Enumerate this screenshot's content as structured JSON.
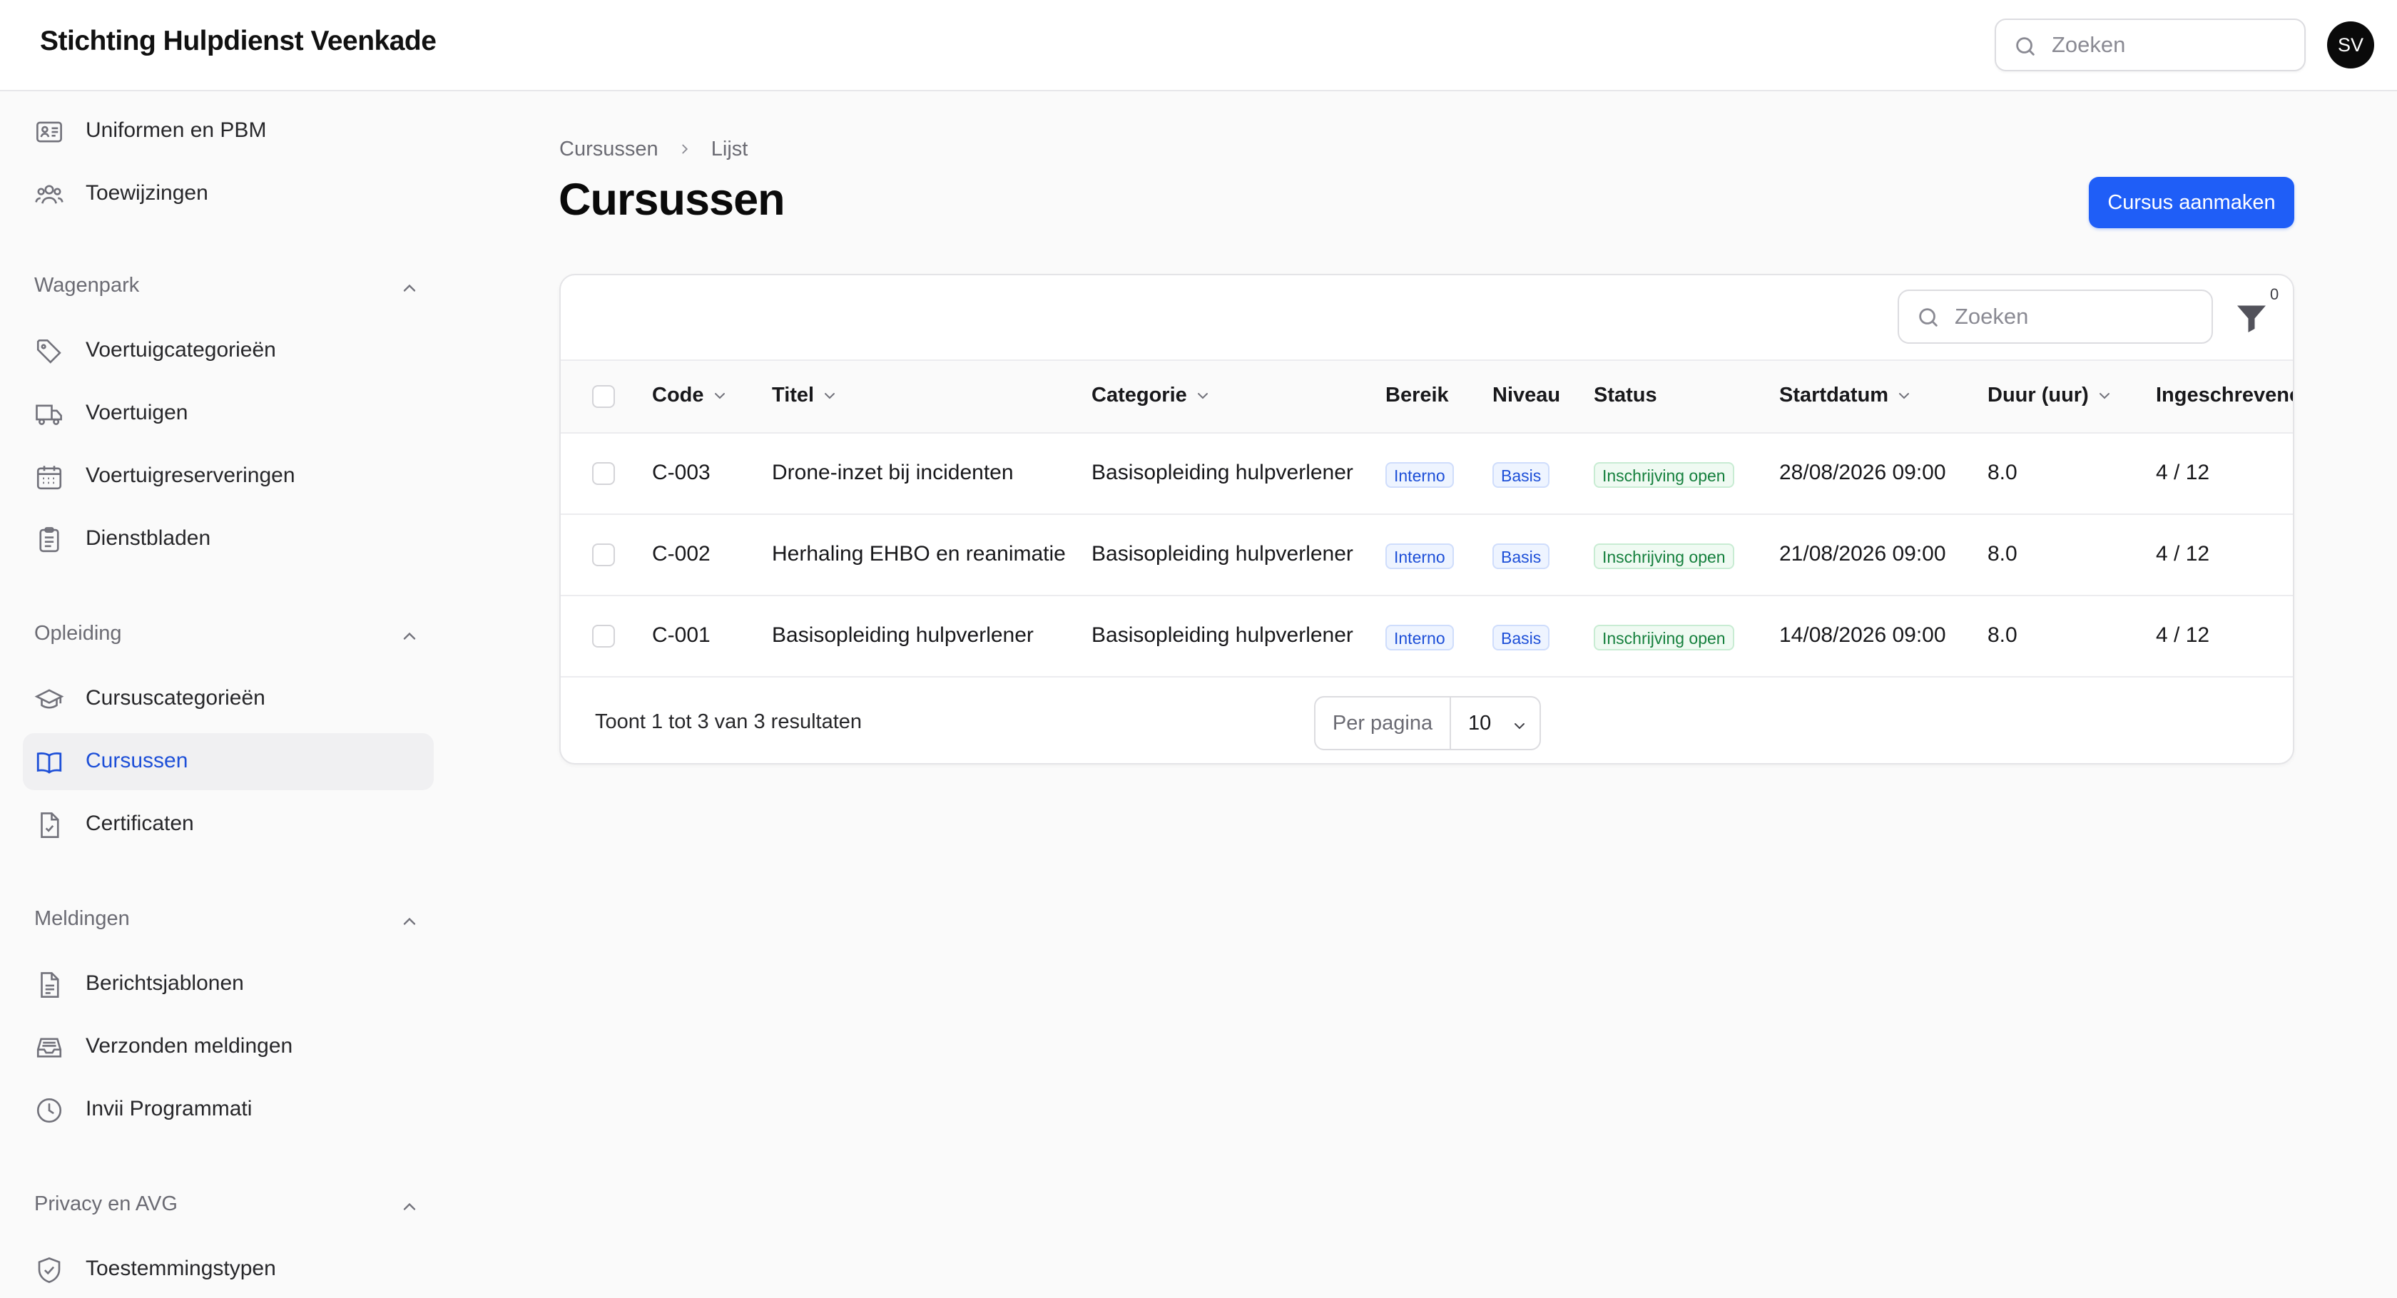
{
  "app": {
    "title": "Stichting Hulpdienst Veenkade",
    "avatar_initials": "SV"
  },
  "header_search": {
    "placeholder": "Zoeken"
  },
  "sidebar": {
    "top_items": [
      {
        "label": "Uniformen en PBM",
        "icon": "id-card-icon"
      },
      {
        "label": "Toewijzingen",
        "icon": "users-icon"
      }
    ],
    "groups": [
      {
        "label": "Wagenpark",
        "items": [
          {
            "label": "Voertuigcategorieën",
            "icon": "tag-icon"
          },
          {
            "label": "Voertuigen",
            "icon": "truck-icon"
          },
          {
            "label": "Voertuigreserveringen",
            "icon": "calendar-icon"
          },
          {
            "label": "Dienstbladen",
            "icon": "clipboard-icon"
          }
        ]
      },
      {
        "label": "Opleiding",
        "items": [
          {
            "label": "Cursuscategorieën",
            "icon": "graduation-cap-icon"
          },
          {
            "label": "Cursussen",
            "icon": "book-open-icon",
            "active": true
          },
          {
            "label": "Certificaten",
            "icon": "document-check-icon"
          }
        ]
      },
      {
        "label": "Meldingen",
        "items": [
          {
            "label": "Berichtsjablonen",
            "icon": "document-text-icon"
          },
          {
            "label": "Verzonden meldingen",
            "icon": "inbox-icon"
          },
          {
            "label": "Invii Programmati",
            "icon": "clock-icon"
          }
        ]
      },
      {
        "label": "Privacy en AVG",
        "items": [
          {
            "label": "Toestemmingstypen",
            "icon": "shield-check-icon"
          }
        ]
      }
    ]
  },
  "breadcrumb": {
    "parent": "Cursussen",
    "current": "Lijst"
  },
  "page": {
    "title": "Cursussen",
    "create_button": "Cursus aanmaken"
  },
  "table": {
    "search_placeholder": "Zoeken",
    "filter_count": "0",
    "columns": {
      "code": "Code",
      "titel": "Titel",
      "categorie": "Categorie",
      "bereik": "Bereik",
      "niveau": "Niveau",
      "status": "Status",
      "startdatum": "Startdatum",
      "duur": "Duur (uur)",
      "ingeschrevenen": "Ingeschrevene"
    },
    "rows": [
      {
        "code": "C-003",
        "titel": "Drone-inzet bij incidenten",
        "categorie": "Basisopleiding hulpverlener",
        "bereik": "Interno",
        "niveau": "Basis",
        "status": "Inschrijving open",
        "startdatum": "28/08/2026 09:00",
        "duur": "8.0",
        "ingeschrevenen": "4 / 12"
      },
      {
        "code": "C-002",
        "titel": "Herhaling EHBO en reanimatie",
        "categorie": "Basisopleiding hulpverlener",
        "bereik": "Interno",
        "niveau": "Basis",
        "status": "Inschrijving open",
        "startdatum": "21/08/2026 09:00",
        "duur": "8.0",
        "ingeschrevenen": "4 / 12"
      },
      {
        "code": "C-001",
        "titel": "Basisopleiding hulpverlener",
        "categorie": "Basisopleiding hulpverlener",
        "bereik": "Interno",
        "niveau": "Basis",
        "status": "Inschrijving open",
        "startdatum": "14/08/2026 09:00",
        "duur": "8.0",
        "ingeschrevenen": "4 / 12"
      }
    ],
    "footer": {
      "summary": "Toont 1 tot 3 van 3 resultaten",
      "per_page_label": "Per pagina",
      "per_page_value": "10"
    }
  },
  "colors": {
    "accent": "#1f5ef7",
    "active_nav_text": "#1d4fd8",
    "badge_blue": "#1d4fd8",
    "badge_green": "#15803d"
  }
}
